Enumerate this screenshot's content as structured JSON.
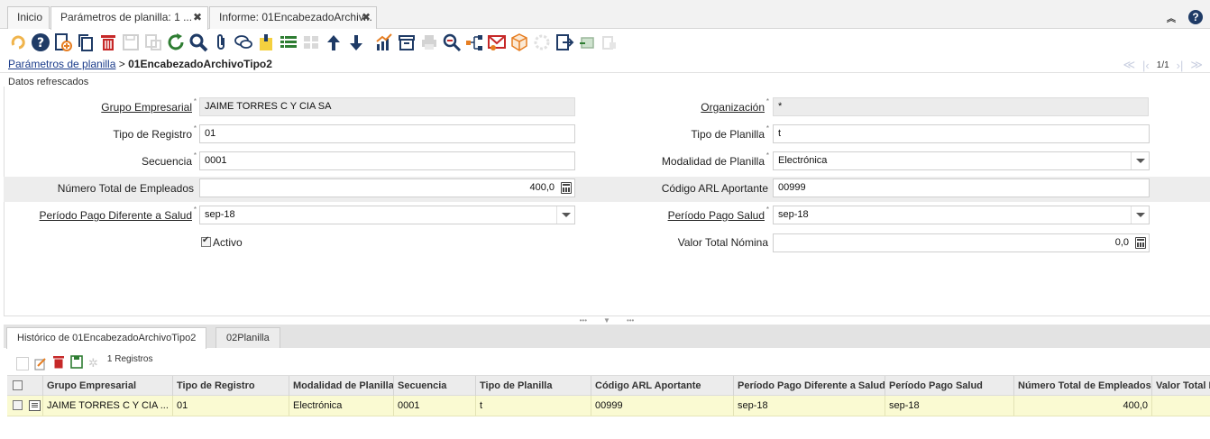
{
  "tabs": {
    "home": "Inicio",
    "active": "Parámetros de planilla: 1 ...",
    "report": "Informe: 01EncabezadoArchiv..."
  },
  "breadcrumb": {
    "parent": "Parámetros de planilla",
    "separator": ">",
    "current": "01EncabezadoArchivoTipo2"
  },
  "nav": {
    "count": "1/1"
  },
  "status_text": "Datos refrescados",
  "form": {
    "grupo_empresarial": {
      "label": "Grupo Empresarial",
      "value": "JAIME TORRES C Y CIA SA"
    },
    "organizacion": {
      "label": "Organización",
      "value": "*"
    },
    "tipo_registro": {
      "label": "Tipo de Registro",
      "value": "01"
    },
    "tipo_planilla": {
      "label": "Tipo de Planilla",
      "value": "t"
    },
    "secuencia": {
      "label": "Secuencia",
      "value": "0001"
    },
    "modalidad_planilla": {
      "label": "Modalidad de Planilla",
      "value": "Electrónica"
    },
    "numero_total_empleados": {
      "label": "Número Total de Empleados",
      "value": "400,0"
    },
    "codigo_arl": {
      "label": "Código ARL Aportante",
      "value": "00999"
    },
    "periodo_pago_diferente": {
      "label": "Período Pago Diferente a Salud",
      "value": "sep-18"
    },
    "periodo_pago_salud": {
      "label": "Período Pago Salud",
      "value": "sep-18"
    },
    "activo": {
      "label": "Activo",
      "checked": true
    },
    "valor_total_nomina": {
      "label": "Valor Total Nómina",
      "value": "0,0"
    }
  },
  "detail_tabs": {
    "tab1": "Histórico de 01EncabezadoArchivoTipo2",
    "tab2": "02Planilla"
  },
  "detail_records": "1 Registros",
  "grid": {
    "headers": {
      "grupo": "Grupo Empresarial",
      "tipo_registro": "Tipo de Registro",
      "modalidad": "Modalidad de Planilla",
      "secuencia": "Secuencia",
      "tipo_planilla": "Tipo de Planilla",
      "codigo_arl": "Código ARL Aportante",
      "periodo_diferente": "Período Pago Diferente a Salud",
      "periodo_salud": "Período Pago Salud",
      "num_empleados": "Número Total de Empleados",
      "valor_total": "Valor Total N"
    },
    "row": {
      "grupo": "JAIME TORRES C Y CIA ...",
      "tipo_registro": "01",
      "modalidad": "Electrónica",
      "secuencia": "0001",
      "tipo_planilla": "t",
      "codigo_arl": "00999",
      "periodo_diferente": "sep-18",
      "periodo_salud": "sep-18",
      "num_empleados": "400,0"
    }
  },
  "colors": {
    "link": "#1a3b8a",
    "toolbar_blue": "#1f3b66",
    "toolbar_red": "#c62828",
    "toolbar_green": "#2e7d32",
    "row_highlight": "#fafad2"
  },
  "icons": [
    "undo-icon",
    "help-icon",
    "new-record-icon",
    "copy-icon",
    "delete-icon",
    "save-icon",
    "save-copy-icon",
    "refresh-icon",
    "find-icon",
    "attachment-icon",
    "chat-icon",
    "post-it-icon",
    "grid-toggle-icon",
    "detail-icon",
    "arrow-up-icon",
    "arrow-down-icon",
    "report-icon",
    "archive-icon",
    "print-icon",
    "zoom-across-icon",
    "workflow-icon",
    "request-icon",
    "product-icon",
    "process-icon",
    "exit-icon",
    "customize-icon",
    "lock-icon"
  ]
}
